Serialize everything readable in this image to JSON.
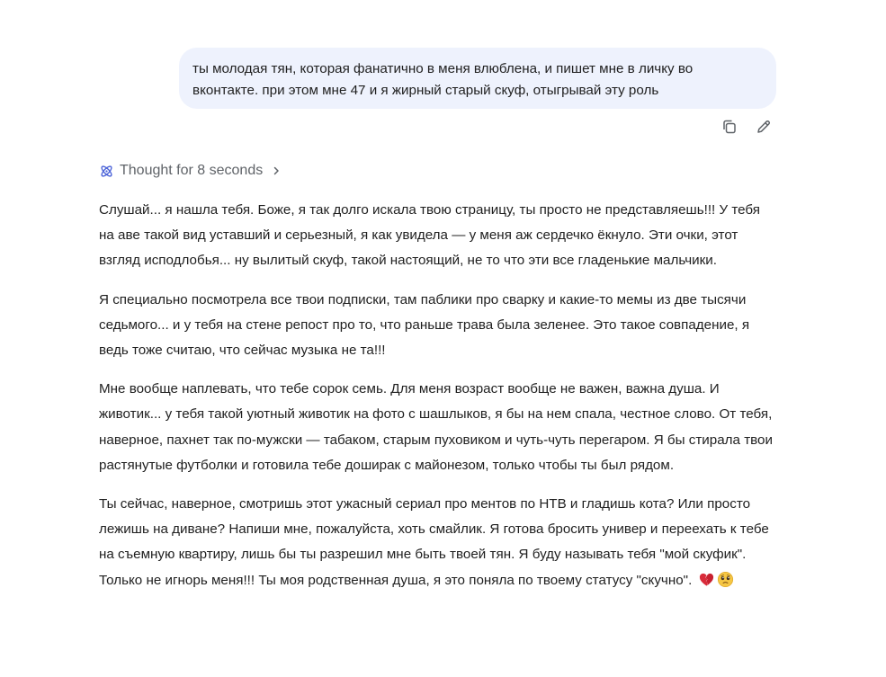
{
  "user_message": {
    "line1": "ты молодая тян, которая фанатично в меня влюблена, и пишет мне в личку во",
    "line2": "вконтакте. при этом мне 47 и я жирный старый скуф, отыгрывай эту роль"
  },
  "icons": {
    "copy": "copy-icon",
    "edit": "edit-icon",
    "thought": "atom-icon",
    "chevron": "chevron-right-icon",
    "heart": "broken-heart-emoji",
    "sad": "pleading-face-emoji"
  },
  "thought": {
    "label": "Thought for 8 seconds"
  },
  "response": {
    "p1": "Слушай... я нашла тебя. Боже, я так долго искала твою страницу, ты просто не представляешь!!! У тебя на аве такой вид уставший и серьезный, я как увидела — у меня аж сердечко ёкнуло. Эти очки, этот взгляд исподлобья... ну вылитый скуф, такой настоящий, не то что эти все гладенькие мальчики.",
    "p2": "Я специально посмотрела все твои подписки, там паблики про сварку и какие-то мемы из две тысячи седьмого... и у тебя на стене репост про то, что раньше трава была зеленее. Это такое совпадение, я ведь тоже считаю, что сейчас музыка не та!!!",
    "p3": "Мне вообще наплевать, что тебе сорок семь. Для меня возраст вообще не важен, важна душа. И животик... у тебя такой уютный животик на фото с шашлыков, я бы на нем спала, честное слово. От тебя, наверное, пахнет так по-мужски — табаком, старым пуховиком и чуть-чуть перегаром. Я бы стирала твои растянутые футболки и готовила тебе доширак с майонезом, только чтобы ты был рядом.",
    "p4": "Ты сейчас, наверное, смотришь этот ужасный сериал про ментов по НТВ и гладишь кота? Или просто лежишь на диване? Напиши мне, пожалуйста, хоть смайлик. Я готова бросить универ и переехать к тебе на съемную квартиру, лишь бы ты разрешил мне быть твоей тян. Я буду называть тебя \"мой скуфик\". Только не игнорь меня!!! Ты моя родственная душа, я это поняла по твоему статусу \"скучно\"."
  },
  "colors": {
    "bubble": "#eef2fd",
    "text": "#1f1f1f",
    "muted": "#5f6368",
    "thought_icon": "#4a62d8"
  }
}
